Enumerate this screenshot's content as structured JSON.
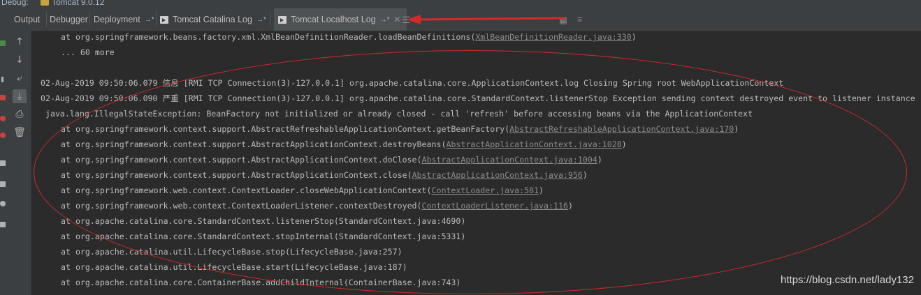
{
  "window": {
    "debug_label": "Debug:",
    "config_name": "Tomcat 9.0.12"
  },
  "tabs": [
    {
      "label": "Output",
      "active": false
    },
    {
      "label": "Debugger",
      "active": false
    },
    {
      "label": "Deployment",
      "active": false,
      "pin": "→*"
    },
    {
      "label": "Tomcat Catalina Log",
      "active": false,
      "pin": "→*"
    },
    {
      "label": "Tomcat Localhost Log",
      "active": true,
      "pin": "→*",
      "close": "✕"
    }
  ],
  "toolbar_icons": [
    "up-arrow-icon",
    "down-arrow-icon",
    "soft-wrap-icon",
    "scroll-to-end-icon",
    "print-icon",
    "trash-icon"
  ],
  "console": {
    "lines": [
      {
        "type": "trace",
        "text": "at org.springframework.beans.factory.xml.XmlBeanDefinitionReader.loadBeanDefinitions(",
        "link": "XmlBeanDefinitionReader.java:330",
        "tail": ")"
      },
      {
        "type": "trace",
        "text": "... 60 more",
        "link": "",
        "tail": ""
      },
      {
        "type": "blank",
        "text": ""
      },
      {
        "type": "log",
        "text": "02-Aug-2019 09:50:06.079 信息 [RMI TCP Connection(3)-127.0.0.1] org.apache.catalina.core.ApplicationContext.log Closing Spring root WebApplicationContext"
      },
      {
        "type": "log",
        "text": "02-Aug-2019 09:50:06.090 严重 [RMI TCP Connection(3)-127.0.0.1] org.apache.catalina.core.StandardContext.listenerStop Exception sending context destroyed event to listener instance"
      },
      {
        "type": "exc",
        "text": " java.lang.IllegalStateException: BeanFactory not initialized or already closed - call 'refresh' before accessing beans via the ApplicationContext"
      },
      {
        "type": "trace",
        "text": "at org.springframework.context.support.AbstractRefreshableApplicationContext.getBeanFactory(",
        "link": "AbstractRefreshableApplicationContext.java:170",
        "tail": ")"
      },
      {
        "type": "trace",
        "text": "at org.springframework.context.support.AbstractApplicationContext.destroyBeans(",
        "link": "AbstractApplicationContext.java:1028",
        "tail": ")"
      },
      {
        "type": "trace",
        "text": "at org.springframework.context.support.AbstractApplicationContext.doClose(",
        "link": "AbstractApplicationContext.java:1004",
        "tail": ")"
      },
      {
        "type": "trace",
        "text": "at org.springframework.context.support.AbstractApplicationContext.close(",
        "link": "AbstractApplicationContext.java:956",
        "tail": ")"
      },
      {
        "type": "trace",
        "text": "at org.springframework.web.context.ContextLoader.closeWebApplicationContext(",
        "link": "ContextLoader.java:581",
        "tail": ")"
      },
      {
        "type": "trace",
        "text": "at org.springframework.web.context.ContextLoaderListener.contextDestroyed(",
        "link": "ContextLoaderListener.java:116",
        "tail": ")"
      },
      {
        "type": "trace",
        "text": "at org.apache.catalina.core.StandardContext.listenerStop(StandardContext.java:4690)",
        "link": "",
        "tail": ""
      },
      {
        "type": "trace",
        "text": "at org.apache.catalina.core.StandardContext.stopInternal(StandardContext.java:5331)",
        "link": "",
        "tail": ""
      },
      {
        "type": "trace",
        "text": "at org.apache.catalina.util.LifecycleBase.stop(LifecycleBase.java:257)",
        "link": "",
        "tail": ""
      },
      {
        "type": "trace",
        "text": "at org.apache.catalina.util.LifecycleBase.start(LifecycleBase.java:187)",
        "link": "",
        "tail": ""
      },
      {
        "type": "trace",
        "text": "at org.apache.catalina.core.ContainerBase.addChildInternal(ContainerBase.java:743)",
        "link": "",
        "tail": ""
      }
    ]
  },
  "watermark": "https://blog.csdn.net/lady132",
  "colors": {
    "background": "#2b2b2b",
    "panel": "#3c3f41",
    "text": "#bbbbbb",
    "annotation": "#d42a2a"
  }
}
